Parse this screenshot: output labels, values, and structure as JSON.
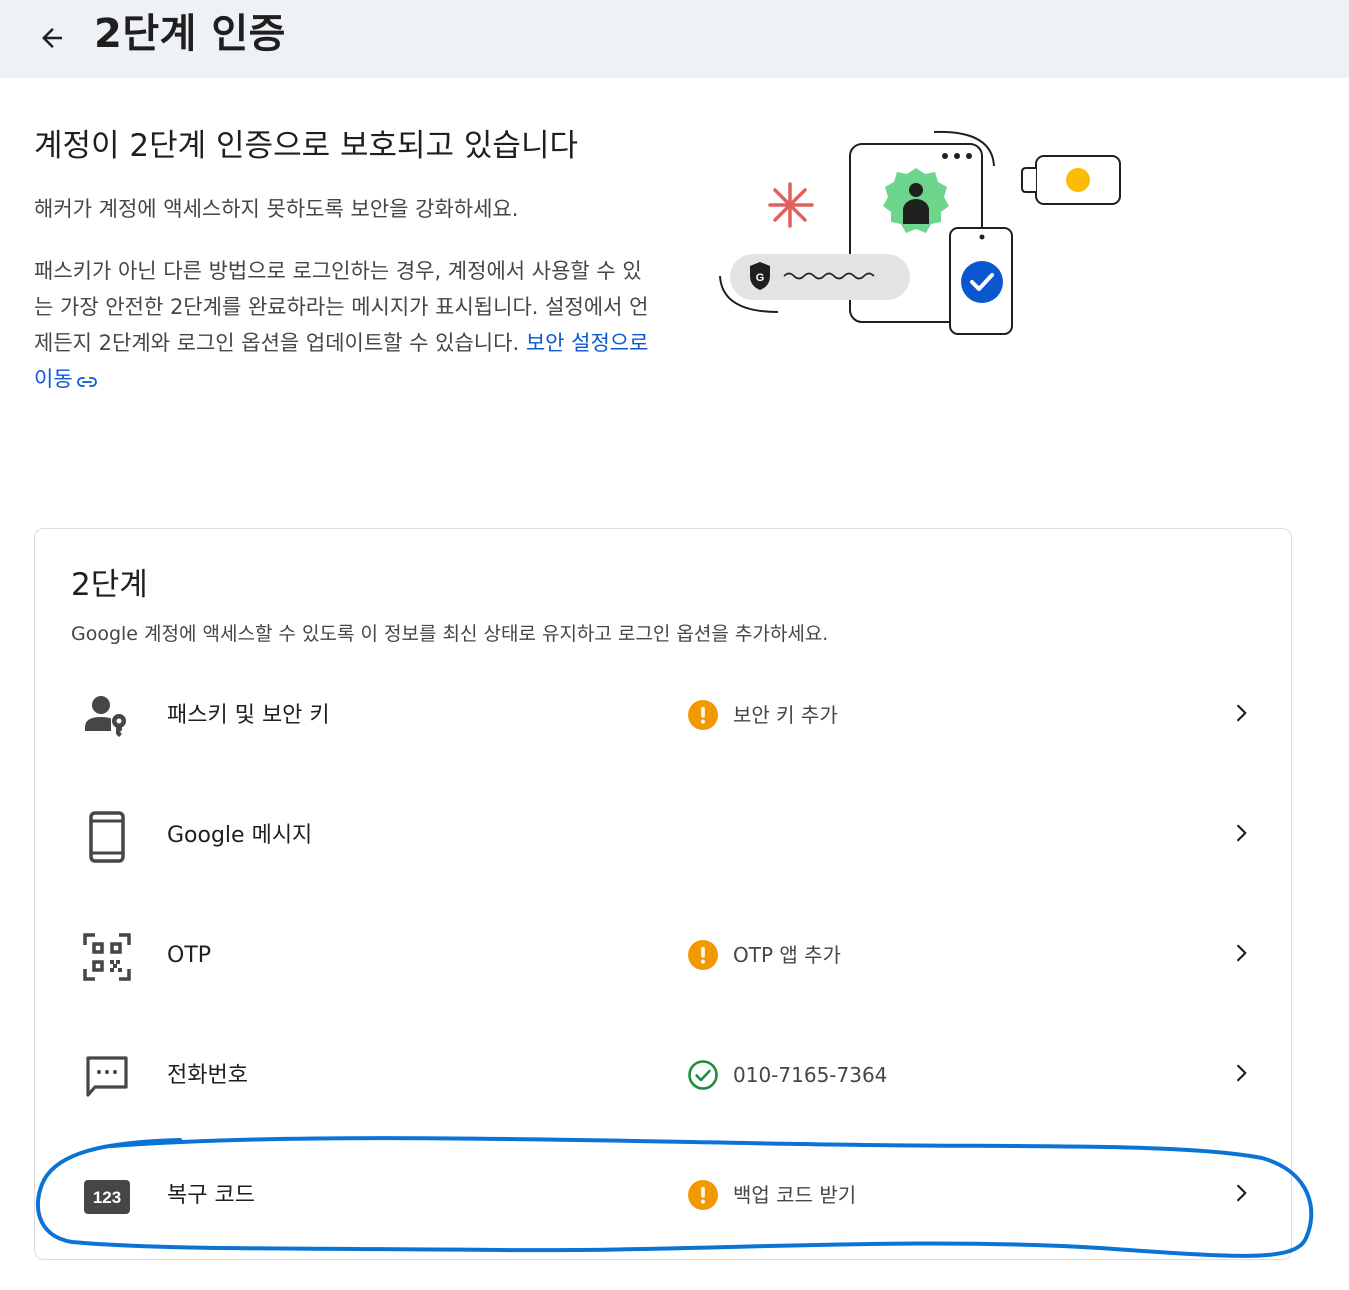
{
  "header": {
    "back_icon": "arrow-left-icon",
    "title": "2단계 인증"
  },
  "hero": {
    "title": "계정이 2단계 인증으로 보호되고 있습니다",
    "subtitle": "해커가 계정에 액세스하지 못하도록 보안을 강화하세요.",
    "body": "패스키가 아닌 다른 방법으로 로그인하는 경우, 계정에서 사용할 수 있는 가장 안전한 2단계를 완료하라는 메시지가 표시됩니다. 설정에서 언제든지 2단계와 로그인 옵션을 업데이트할 수 있습니다.",
    "link_text": "보안 설정으로 이동",
    "link_icon": "link-icon"
  },
  "section": {
    "title": "2단계",
    "description": "Google 계정에 액세스할 수 있도록 이 정보를 최신 상태로 유지하고 로그인 옵션을 추가하세요.",
    "rows": [
      {
        "label": "패스키 및 보안 키",
        "icon": "passkey-icon",
        "status_icon": "warning-icon",
        "status": "보안 키 추가"
      },
      {
        "label": "Google 메시지",
        "icon": "phone-icon",
        "status_icon": "",
        "status": ""
      },
      {
        "label": "OTP",
        "icon": "qr-code-icon",
        "status_icon": "warning-icon",
        "status": "OTP 앱 추가"
      },
      {
        "label": "전화번호",
        "icon": "sms-icon",
        "status_icon": "check-circle-icon",
        "status": "010-7165-7364"
      },
      {
        "label": "복구 코드",
        "icon": "number-badge-icon",
        "icon_text": "123",
        "status_icon": "warning-icon",
        "status": "백업 코드 받기"
      }
    ]
  },
  "colors": {
    "header_bg": "#eef1f5",
    "link": "#0b57d0",
    "warning": "#f29900",
    "success": "#1e8e3e",
    "annotation": "#0a74d6"
  }
}
